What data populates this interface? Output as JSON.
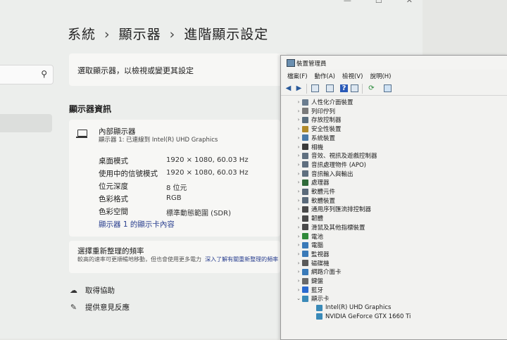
{
  "settings": {
    "breadcrumb": [
      "系統",
      "顯示器",
      "進階顯示設定"
    ],
    "select_display_label": "選取顯示器，以檢視或變更其設定",
    "section_title": "顯示器資訊",
    "monitor": {
      "name": "內部顯示器",
      "connection": "顯示器 1: 已連線到 Intel(R) UHD Graphics"
    },
    "rows": [
      {
        "label": "桌面模式",
        "value": "1920 × 1080, 60.03 Hz"
      },
      {
        "label": "使用中的信號模式",
        "value": "1920 × 1080, 60.03 Hz"
      },
      {
        "label": "位元深度",
        "value": "8 位元"
      },
      {
        "label": "色彩格式",
        "value": "RGB"
      },
      {
        "label": "色彩空間",
        "value": "標準動態範圍 (SDR)"
      }
    ],
    "adapter_properties_link": "顯示器 1 的顯示卡內容",
    "refresh": {
      "title": "選擇重新整理的頻率",
      "description": "較高的速率可更順暢地移動，但也會使用更多電力",
      "link": "深入了解有關重新整理的頻率"
    },
    "help": [
      {
        "label": "取得協助",
        "icon": "help-icon"
      },
      {
        "label": "提供意見反應",
        "icon": "feedback-icon"
      }
    ]
  },
  "device_manager": {
    "title": "裝置管理員",
    "menu": [
      "檔案(F)",
      "動作(A)",
      "檢視(V)",
      "說明(H)"
    ],
    "categories": [
      {
        "label": "人性化介面裝置",
        "color": "#6b7d8f"
      },
      {
        "label": "列印佇列",
        "color": "#7a7a7a"
      },
      {
        "label": "存放控制器",
        "color": "#5a6e7e"
      },
      {
        "label": "安全性裝置",
        "color": "#b08a2a"
      },
      {
        "label": "系統裝置",
        "color": "#4a7aa8"
      },
      {
        "label": "相機",
        "color": "#3a3a3a"
      },
      {
        "label": "音效、視訊及遊戲控制器",
        "color": "#5f6f7f"
      },
      {
        "label": "音訊處理物件 (APO)",
        "color": "#5f6f7f"
      },
      {
        "label": "音訊輸入與輸出",
        "color": "#5f6f7f"
      },
      {
        "label": "處理器",
        "color": "#2f6a3a"
      },
      {
        "label": "軟體元件",
        "color": "#5a6a7a"
      },
      {
        "label": "軟體裝置",
        "color": "#5a6a7a"
      },
      {
        "label": "通用序列匯流排控制器",
        "color": "#4a4a4a"
      },
      {
        "label": "韌體",
        "color": "#4a4a4a"
      },
      {
        "label": "滑鼠及其他指標裝置",
        "color": "#4a4a4a"
      },
      {
        "label": "電池",
        "color": "#2f8a3a"
      },
      {
        "label": "電腦",
        "color": "#3a7ab8"
      },
      {
        "label": "監視器",
        "color": "#3a7ab8"
      },
      {
        "label": "磁碟機",
        "color": "#5a5a5a"
      },
      {
        "label": "網路介面卡",
        "color": "#3a7ab8"
      },
      {
        "label": "鍵盤",
        "color": "#6a6a6a"
      },
      {
        "label": "藍牙",
        "color": "#2a6ad0"
      },
      {
        "label": "顯示卡",
        "color": "#3a8ab8"
      }
    ],
    "display_adapters": [
      "Intel(R) UHD Graphics",
      "NVIDIA GeForce GTX 1660 Ti"
    ]
  }
}
